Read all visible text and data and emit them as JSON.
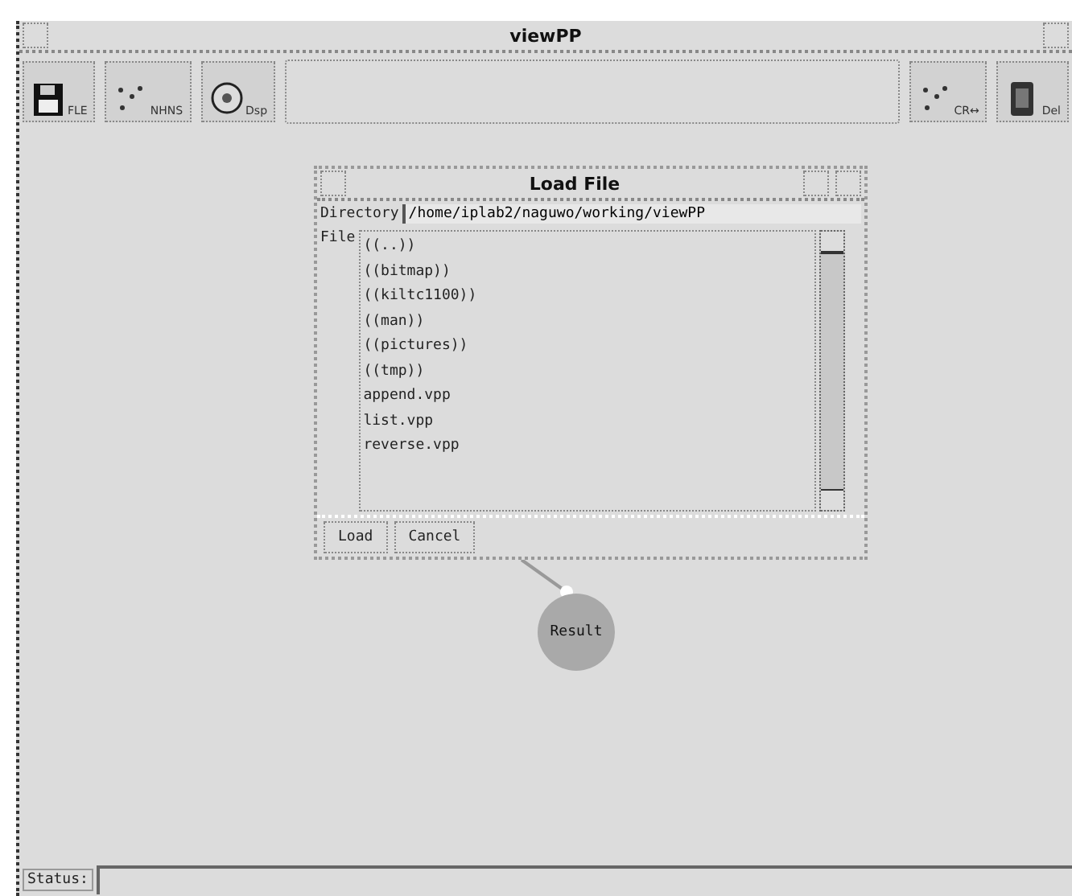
{
  "window": {
    "title": "viewPP"
  },
  "toolbar": {
    "left": [
      {
        "kind": "disk",
        "label": "FLE"
      },
      {
        "kind": "dots",
        "label": "NHNS"
      },
      {
        "kind": "face",
        "label": "Dsp"
      }
    ],
    "right": [
      {
        "kind": "dots",
        "label": "CR↔"
      },
      {
        "kind": "can",
        "label": "Del"
      }
    ]
  },
  "dialog": {
    "title": "Load File",
    "directory_label": "Directory",
    "directory": "/home/iplab2/naguwo/working/viewPP",
    "file_label": "File",
    "files": [
      {
        "name": "((..))",
        "selected": false
      },
      {
        "name": "((bitmap))",
        "selected": false
      },
      {
        "name": "((kiltc1100))",
        "selected": false
      },
      {
        "name": "((man))",
        "selected": false
      },
      {
        "name": "((pictures))",
        "selected": false
      },
      {
        "name": "((tmp))",
        "selected": false
      },
      {
        "name": "append.vpp",
        "selected": false
      },
      {
        "name": "list.vpp",
        "selected": false
      },
      {
        "name": "reverse.vpp",
        "selected": false
      }
    ],
    "buttons": [
      "Load",
      "Cancel"
    ]
  },
  "node": {
    "label": "Result"
  },
  "status_bar": {
    "label": "Status:"
  }
}
